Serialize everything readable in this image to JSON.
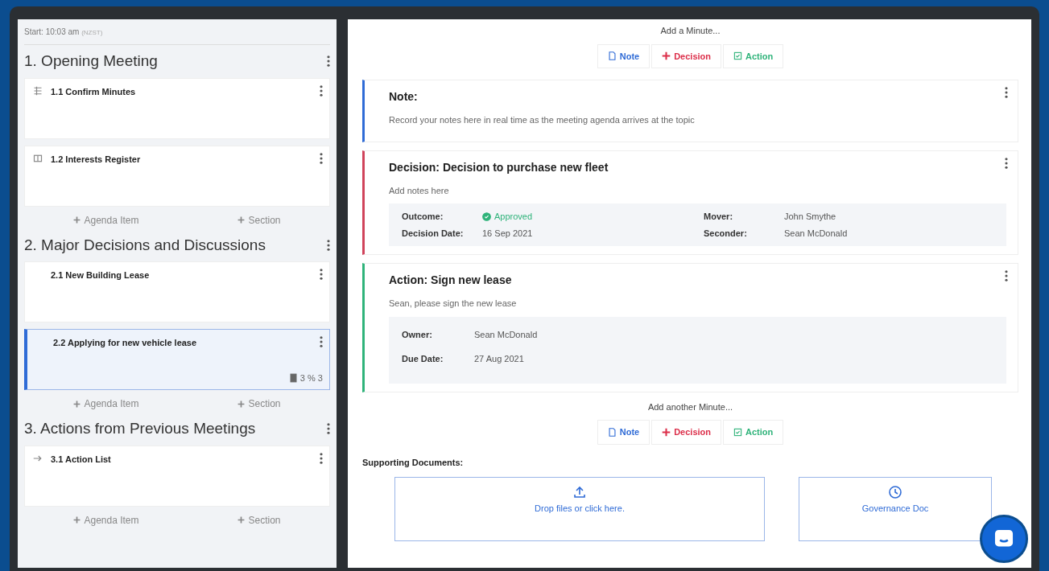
{
  "start": {
    "label": "Start: 10:03 am",
    "timezone": "(NZST)"
  },
  "sections": [
    {
      "title": "1. Opening Meeting",
      "items": [
        {
          "title": "1.1 Confirm Minutes",
          "kind": "list",
          "selected": false
        },
        {
          "title": "1.2 Interests Register",
          "kind": "register",
          "selected": false
        }
      ],
      "add_links": [
        "Agenda Item",
        "Section"
      ]
    },
    {
      "title": "2. Major Decisions and Discussions",
      "items": [
        {
          "title": "2.1 New Building Lease",
          "selected": false
        },
        {
          "title": "2.2 Applying for new vehicle lease",
          "selected": true,
          "badge": "3 % 3"
        }
      ],
      "add_links": [
        "Agenda Item",
        "Section"
      ]
    },
    {
      "title": "3. Actions from Previous Meetings",
      "items": [
        {
          "title": "3.1 Action List",
          "kind": "link",
          "selected": false
        }
      ],
      "add_links": [
        "Agenda Item",
        "Section"
      ]
    }
  ],
  "composer_top": {
    "prompt": "Add a Minute...",
    "buttons": [
      {
        "kind": "note",
        "label": "Note"
      },
      {
        "kind": "decision",
        "label": "Decision"
      },
      {
        "kind": "action",
        "label": "Action"
      }
    ]
  },
  "minutes": [
    {
      "kind": "note",
      "title": "Note:",
      "body": "Record your notes here in real time as the meeting agenda arrives at the topic"
    },
    {
      "kind": "decision",
      "title": "Decision: Decision to purchase new fleet",
      "body": "Add notes here",
      "detail_rows": [
        [
          {
            "label": "Outcome:",
            "value": "Approved",
            "kind": "status"
          },
          {
            "label": "Mover:",
            "value": "John Smythe"
          }
        ],
        [
          {
            "label": "Decision Date:",
            "value": "16 Sep 2021"
          },
          {
            "label": "Seconder:",
            "value": "Sean McDonald"
          }
        ]
      ]
    },
    {
      "kind": "action",
      "title": "Action: Sign new lease",
      "body": "Sean, please sign the new lease",
      "detail_rows": [
        [
          {
            "label": "Owner:",
            "value": "Sean McDonald"
          }
        ],
        [
          {
            "label": "Due Date:",
            "value": "27 Aug 2021"
          }
        ]
      ]
    }
  ],
  "composer_bottom": {
    "prompt": "Add another Minute...",
    "buttons": [
      {
        "kind": "note",
        "label": "Note"
      },
      {
        "kind": "decision",
        "label": "Decision"
      },
      {
        "kind": "action",
        "label": "Action"
      }
    ]
  },
  "supporting_documents": {
    "title": "Supporting Documents:",
    "dropzone": "Drop files or click here.",
    "governance": "Governance Doc"
  }
}
